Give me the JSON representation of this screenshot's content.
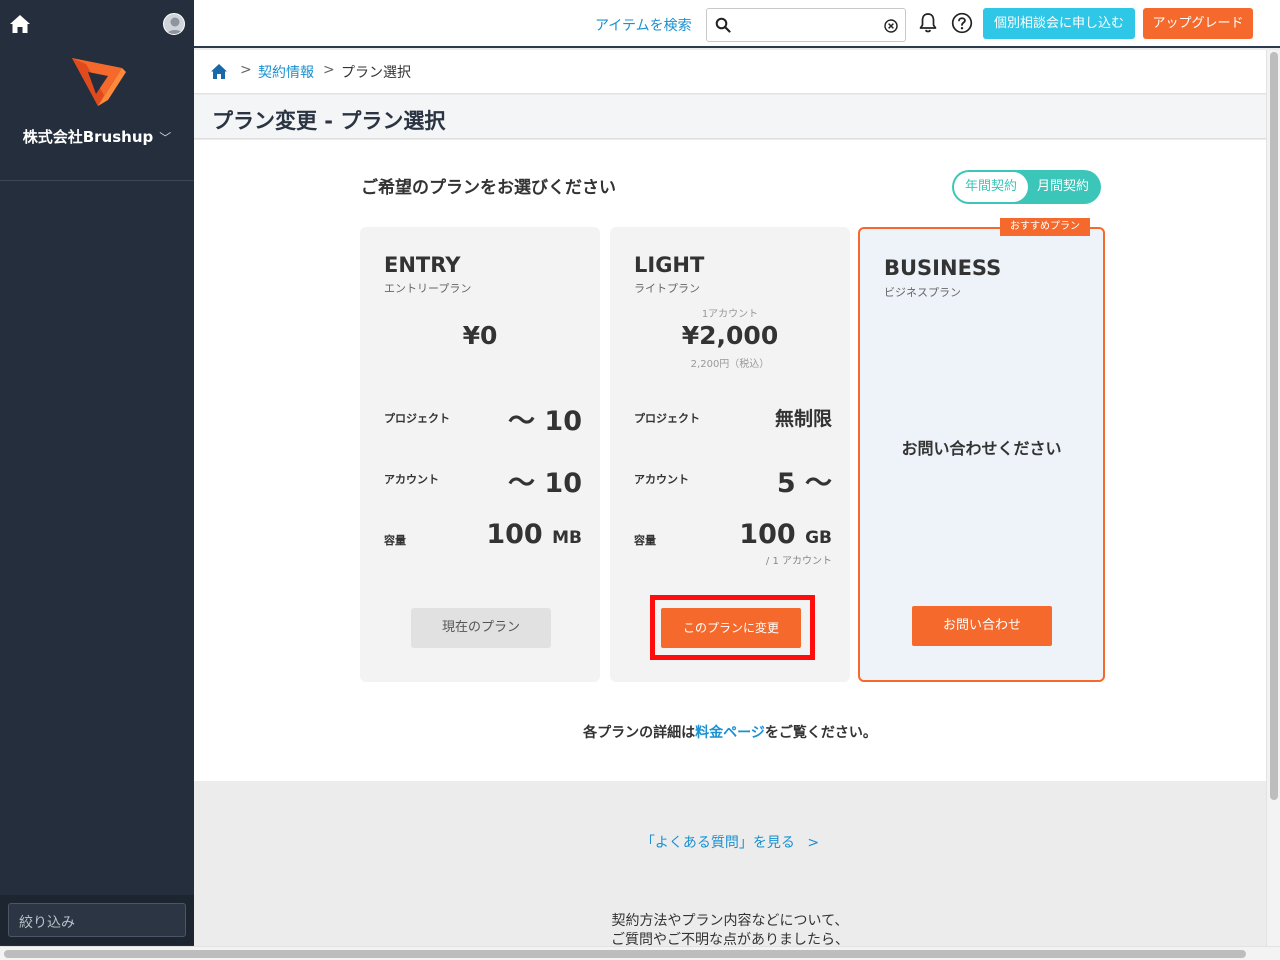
{
  "sidebar": {
    "company_name": "株式会社Brushup",
    "filter_placeholder": "絞り込み",
    "icons": [
      "home-icon",
      "user-avatar-icon",
      "brushup-logo",
      "chevron-down-icon"
    ]
  },
  "topbar": {
    "search_link": "アイテムを検索",
    "search_value": "",
    "consult_button": "個別相談会に申し込む",
    "upgrade_button": "アップグレード",
    "icons": [
      "search-icon",
      "clear-icon",
      "bell-icon",
      "help-icon"
    ]
  },
  "breadcrumb": {
    "sep": ">",
    "items": [
      "契約情報",
      "プラン選択"
    ]
  },
  "page_title": "プラン変更 - プラン選択",
  "lead": "ご希望のプランをお選びください",
  "billing_toggle": {
    "options": [
      "年間契約",
      "月間契約"
    ],
    "selected": "年間契約"
  },
  "plans": {
    "entry": {
      "name": "ENTRY",
      "sub": "エントリープラン",
      "price": "¥0",
      "project_label": "プロジェクト",
      "project_value": "～ 10",
      "account_label": "アカウント",
      "account_value": "～ 10",
      "storage_label": "容量",
      "storage_value": "100",
      "storage_unit": "MB",
      "button": "現在のプラン"
    },
    "light": {
      "name": "LIGHT",
      "sub": "ライトプラン",
      "price_prefix": "1アカウント",
      "price": "¥2,000",
      "price_tax": "2,200円（税込）",
      "project_label": "プロジェクト",
      "project_value": "無制限",
      "account_label": "アカウント",
      "account_value": "5 ～",
      "storage_label": "容量",
      "storage_value": "100",
      "storage_unit": "GB",
      "storage_note": "/ 1 アカウント",
      "button": "このプランに変更"
    },
    "business": {
      "badge": "おすすめプラン",
      "name": "BUSINESS",
      "sub": "ビジネスプラン",
      "contact_text": "お問い合わせください",
      "button": "お問い合わせ"
    }
  },
  "details": {
    "prefix": "各プランの詳細は",
    "link": "料金ページ",
    "suffix": "をご覧ください。"
  },
  "footer": {
    "faq_link": "「よくある質問」を見る",
    "faq_chevron": "＞",
    "text_line1": "契約方法やプラン内容などについて、",
    "text_line2": "ご質問やご不明な点がありましたら、"
  },
  "colors": {
    "sidebar_bg": "#242e3c",
    "accent_orange": "#f56a2c",
    "accent_cyan": "#2ec7e8",
    "toggle_teal": "#3cc6b9",
    "link_blue": "#1a91d1",
    "highlight_red": "#ff0c0c"
  }
}
